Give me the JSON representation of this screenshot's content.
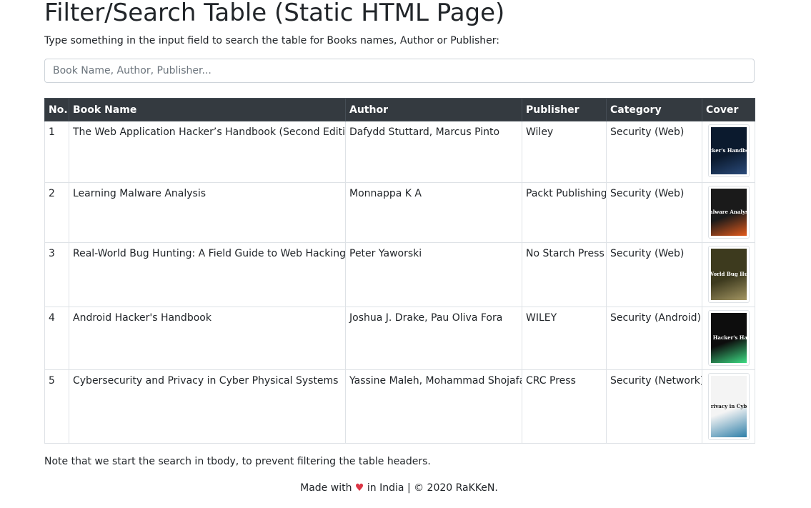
{
  "page": {
    "title": "Filter/Search Table (Static HTML Page)",
    "intro": "Type something in the input field to search the table for Books names, Author or Publisher:",
    "note": "Note that we start the search in tbody, to prevent filtering the table headers."
  },
  "search": {
    "placeholder": "Book Name, Author, Publisher...",
    "value": ""
  },
  "table": {
    "headers": {
      "no": "No.",
      "name": "Book Name",
      "author": "Author",
      "publisher": "Publisher",
      "category": "Category",
      "cover": "Cover"
    },
    "rows": [
      {
        "no": "1",
        "name": "The Web Application Hacker’s Handbook (Second Edition)",
        "author": "Dafydd Stuttard, Marcus Pinto",
        "publisher": "Wiley",
        "category": "Security (Web)",
        "cover_title": "Hacker's Handbook",
        "cover_colors": [
          "#0b1a2e",
          "#2a4a7a"
        ]
      },
      {
        "no": "2",
        "name": "Learning Malware Analysis",
        "author": "Monnappa K A",
        "publisher": "Packt Publishing",
        "category": "Security (Web)",
        "cover_title": "Malware Analysis",
        "cover_colors": [
          "#1a1a1a",
          "#e35b1d"
        ]
      },
      {
        "no": "3",
        "name": "Real-World Bug Hunting: A Field Guide to Web Hacking",
        "author": "Peter Yaworski",
        "publisher": "No Starch Press",
        "category": "Security (Web)",
        "cover_title": "Real-World Bug Hunting",
        "cover_colors": [
          "#3d3a1e",
          "#a39562"
        ]
      },
      {
        "no": "4",
        "name": "Android Hacker's Handbook",
        "author": "Joshua J. Drake, Pau Oliva Fora",
        "publisher": "WILEY",
        "category": "Security (Android)",
        "cover_title": "Android Hacker's Handbook",
        "cover_colors": [
          "#0d0d0d",
          "#3ddc84"
        ]
      },
      {
        "no": "5",
        "name": "Cybersecurity and Privacy in Cyber Physical Systems",
        "author": "Yassine Maleh, Mohammad Shojafar",
        "publisher": "CRC Press",
        "category": "Security (Network)",
        "cover_title": "Cybersecurity and Privacy in Cyber Physical Systems",
        "cover_colors": [
          "#f4f4f4",
          "#2e7fa8"
        ]
      }
    ]
  },
  "footer": {
    "before": "Made with ",
    "heart": "♥",
    "after": " in India | © 2020 RaKKeN."
  }
}
